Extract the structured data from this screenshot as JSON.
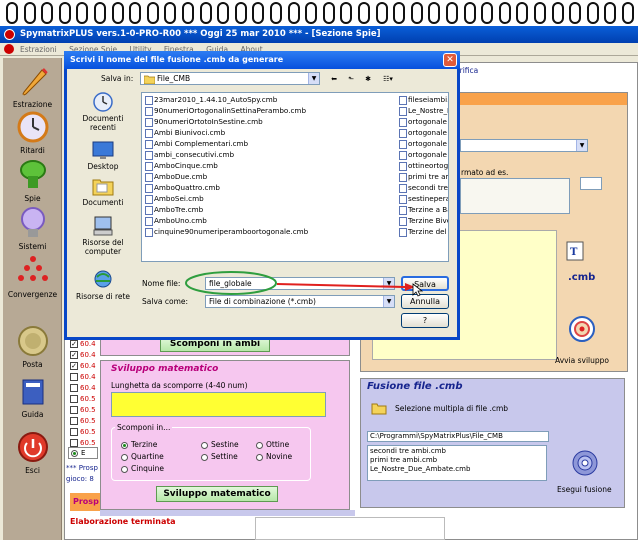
{
  "app": {
    "title": "SpymatrixPLUS vers.1-0-PRO-R00  ***  Oggi 25 mar 2010  ***  - [Sezione Spie]",
    "menu": [
      "Estrazioni",
      "Sezione Spie",
      "Utility",
      "Finestra",
      "Guida",
      "About"
    ]
  },
  "nav": [
    {
      "label": "Estrazione",
      "icon": "pencil-icon"
    },
    {
      "label": "Ritardi",
      "icon": "clock-icon"
    },
    {
      "label": "Spie",
      "icon": "flashlight-icon"
    },
    {
      "label": "Sistemi",
      "icon": "bulb-icon"
    },
    {
      "label": "Convergenze",
      "icon": "pyramid-icon"
    },
    {
      "label": "Posta",
      "icon": "coin-icon"
    },
    {
      "label": "Guida",
      "icon": "book-icon"
    },
    {
      "label": "Esci",
      "icon": "exit-icon"
    }
  ],
  "dialog": {
    "title": "Scrivi il nome del file fusione .cmb da generare",
    "save_in_label": "Salva in:",
    "save_in_value": "File_CMB",
    "places": [
      "Documenti recenti",
      "Desktop",
      "Documenti",
      "Risorse del computer",
      "Risorse di rete"
    ],
    "files_col1": [
      "23mar2010_1.44.10_AutoSpy.cmb",
      "90numeriOrtogonalinSettinaPerambo.cmb",
      "90numeriOrtotoInSestine.cmb",
      "Ambi Biunivoci.cmb",
      "Ambi Complementari.cmb",
      "ambi_consecutivi.cmb",
      "AmboCinque.cmb",
      "AmboDue.cmb",
      "AmboQuattro.cmb",
      "AmboSei.cmb",
      "AmboTre.cmb",
      "AmboUno.cmb",
      "cinquine90numeriperamboortogonale.cmb"
    ],
    "files_col2": [
      "fileseiambi.cmb",
      "Le_Nostre_D",
      "ortogonale 90",
      "ortogonale 90",
      "ortogonale 90",
      "ortogonale in",
      "ottineortogon",
      "primi tre ambi",
      "secondi tre a",
      "sestineperam",
      "Terzine a Bas",
      "Terzine Bivert",
      "Terzine del G"
    ],
    "filename_label": "Nome file:",
    "filename_value": "file_globale",
    "savetype_label": "Salva come:",
    "savetype_value": "File di combinazione (*.cmb)",
    "save_btn": "Salva",
    "cancel_btn": "Annulla",
    "help_btn": "?"
  },
  "background": {
    "mdi_title_right": "erifica",
    "orange_text": "rmato ad es.",
    "cmb_label": ".cmb",
    "avvia_label": "Avvia sviluppo",
    "scomponi_btn": "Scomponi in ambi",
    "checks": [
      "60.4",
      "60.4",
      "60.4",
      "60.4",
      "60.4",
      "60.5",
      "60.5",
      "60.5",
      "60.5",
      "60.5"
    ],
    "e_label": "E",
    "prosp_line": "*** Prosp",
    "gioco_line": "gioco: 8",
    "prosp_tab": "Prosp",
    "status_text": "Elaborazione terminata"
  },
  "sviluppo": {
    "title": "Sviluppo matematico",
    "length_label": "Lunghetta da scomporre (4-40 num)",
    "scomponi_group": "Scomponi in...",
    "options": [
      {
        "label": "Terzine",
        "checked": true
      },
      {
        "label": "Sestine",
        "checked": false
      },
      {
        "label": "Ottine",
        "checked": false
      },
      {
        "label": "Quartine",
        "checked": false
      },
      {
        "label": "Settine",
        "checked": false
      },
      {
        "label": "Novine",
        "checked": false
      },
      {
        "label": "Cinquine",
        "checked": false
      }
    ],
    "button": "Sviluppo matematico"
  },
  "fusione": {
    "title": "Fusione file .cmb",
    "multi_label": "Selezione multipla di file .cmb",
    "path": "C:\\Programmi\\SpyMatrixPlus\\File_CMB",
    "files": [
      "secondi tre ambi.cmb",
      "primi tre ambi.cmb",
      "Le_Nostre_Due_Ambate.cmb"
    ],
    "button": "Esegui fusione"
  },
  "colors": {
    "xp_blue": "#0a5fd8",
    "orange_panel": "#f3d7b1",
    "pink_panel": "#f6c7ef",
    "lavender_panel": "#c8c8ec",
    "yellow_input": "#ffff33",
    "green_ellipse": "#2f9e3f",
    "red_arrow": "#e0201e"
  }
}
